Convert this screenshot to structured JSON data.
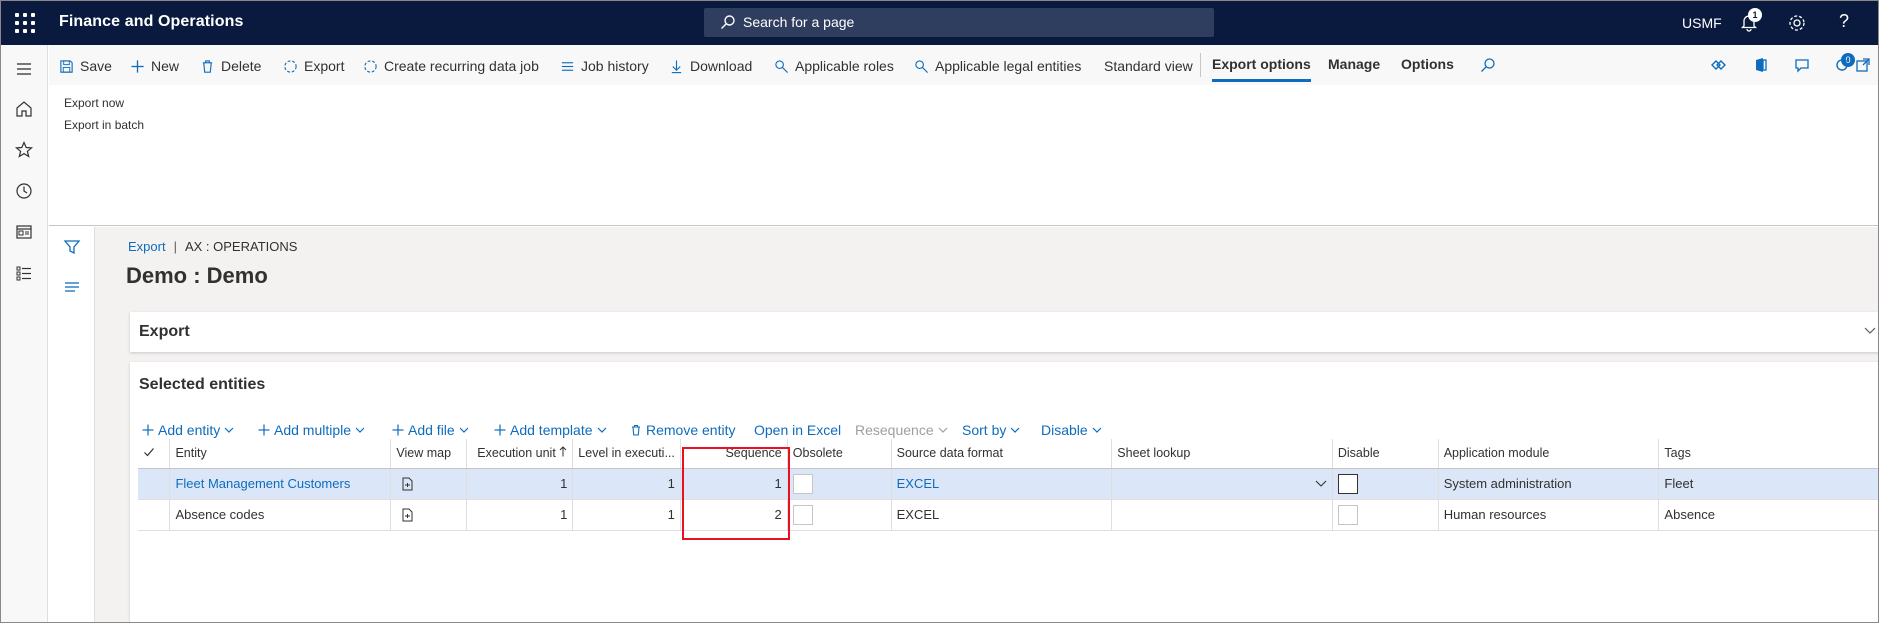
{
  "topbar": {
    "app_title": "Finance and Operations",
    "search_placeholder": "Search for a page",
    "company": "USMF",
    "notification_count": "1",
    "help": "?"
  },
  "action_pane": {
    "save": "Save",
    "new": "New",
    "delete": "Delete",
    "export": "Export",
    "create_recurring": "Create recurring data job",
    "job_history": "Job history",
    "download": "Download",
    "applicable_roles": "Applicable roles",
    "applicable_legal_entities": "Applicable legal entities",
    "standard_view": "Standard view",
    "tabs": [
      "Export options",
      "Manage",
      "Options"
    ],
    "active_tab": "Export options",
    "badge_count": "0"
  },
  "export_options": {
    "items": [
      "Export now",
      "Export in batch"
    ]
  },
  "breadcrumb": {
    "link": "Export",
    "context": "AX : OPERATIONS"
  },
  "page_title": "Demo : Demo",
  "sections": {
    "export": "Export",
    "selected_entities": "Selected entities"
  },
  "grid_toolbar": {
    "add_entity": "Add entity",
    "add_multiple": "Add multiple",
    "add_file": "Add file",
    "add_template": "Add template",
    "remove_entity": "Remove entity",
    "open_in_excel": "Open in Excel",
    "resequence": "Resequence",
    "sort_by": "Sort by",
    "disable": "Disable"
  },
  "grid": {
    "columns": [
      "Entity",
      "View map",
      "Execution unit",
      "Level in executi...",
      "Sequence",
      "Obsolete",
      "Source data format",
      "Sheet lookup",
      "Disable",
      "Application module",
      "Tags"
    ],
    "rows": [
      {
        "entity": "Fleet Management Customers",
        "execution_unit": "1",
        "level": "1",
        "sequence": "1",
        "source_format": "EXCEL",
        "application_module": "System administration",
        "tags": "Fleet"
      },
      {
        "entity": "Absence codes",
        "execution_unit": "1",
        "level": "1",
        "sequence": "2",
        "source_format": "EXCEL",
        "application_module": "Human resources",
        "tags": "Absence"
      }
    ]
  },
  "colors": {
    "topbar": "#0a1a3f",
    "accent": "#0f6cbd",
    "selected_row": "#dbe7f8",
    "highlight_box": "#e81123"
  }
}
